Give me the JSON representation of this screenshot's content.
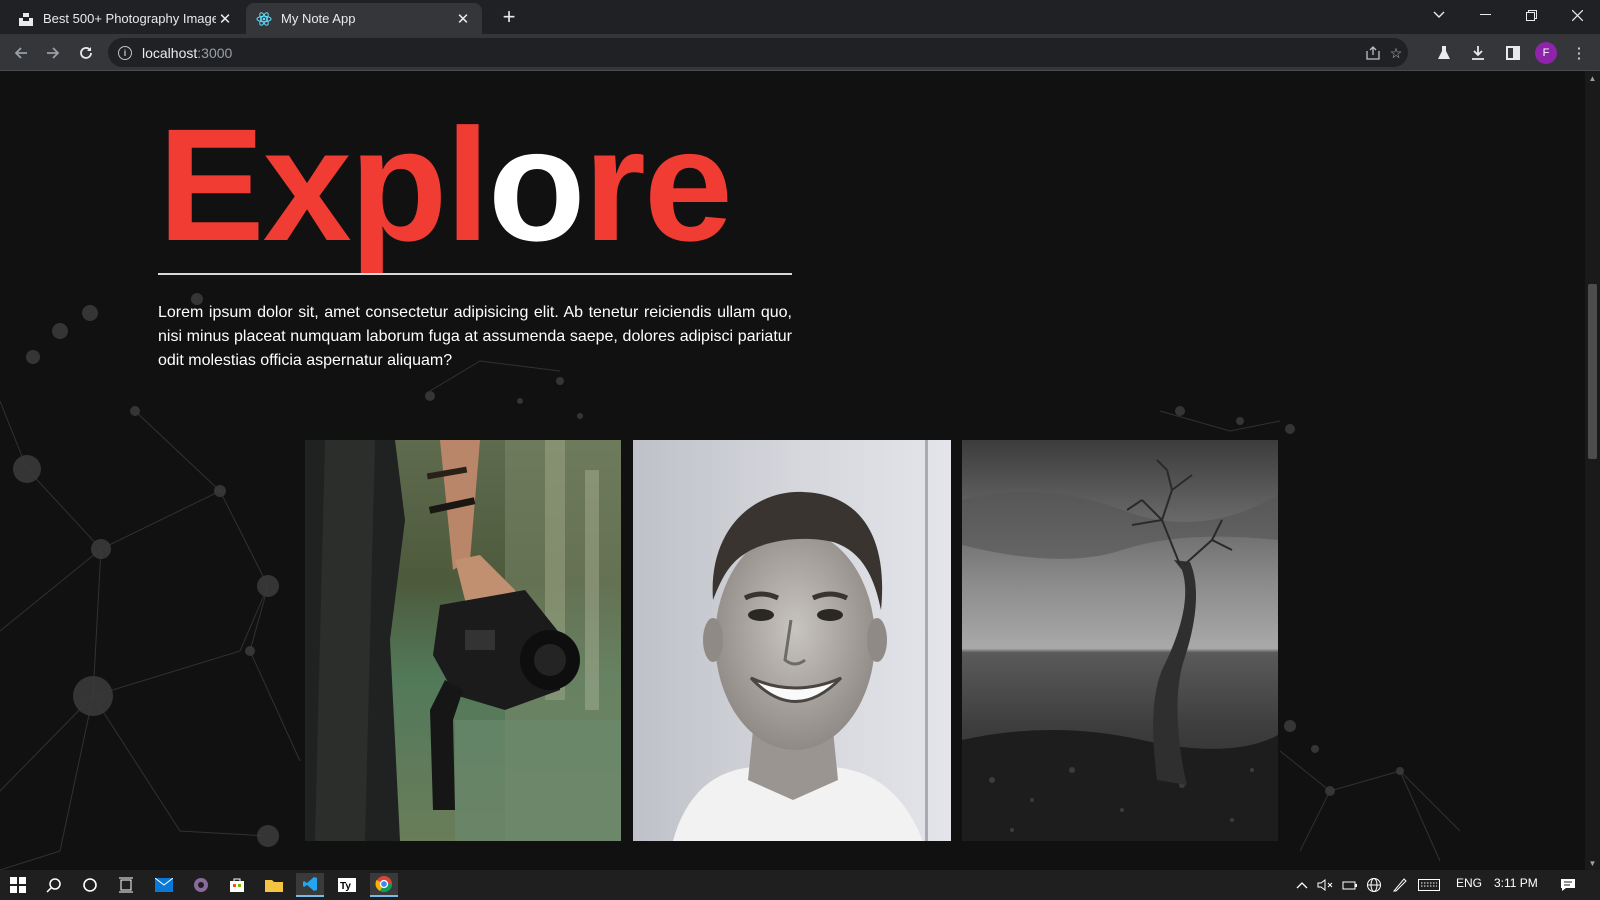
{
  "browser": {
    "tabs": [
      {
        "title": "Best 500+ Photography Images [",
        "favicon": "unsplash-icon",
        "active": false
      },
      {
        "title": "My Note App",
        "favicon": "react-icon",
        "active": true
      }
    ],
    "url_host": "localhost",
    "url_port": ":3000",
    "profile_initial": "F"
  },
  "page": {
    "title_red_1": "Expl",
    "title_white": "o",
    "title_red_2": "re",
    "description": "Lorem ipsum dolor sit, amet consectetur adipisicing elit. Ab tenetur reiciendis ullam quo, nisi minus placeat numquam laborum fuga at assumenda saepe, dolores adipisci pariatur odit molestias officia aspernatur aliquam?",
    "accent_color": "#f13c34",
    "photos": [
      {
        "name": "photo-camera-hand"
      },
      {
        "name": "photo-smiling-man"
      },
      {
        "name": "photo-lone-tree"
      }
    ]
  },
  "taskbar": {
    "language": "ENG",
    "time": "3:11 PM"
  }
}
